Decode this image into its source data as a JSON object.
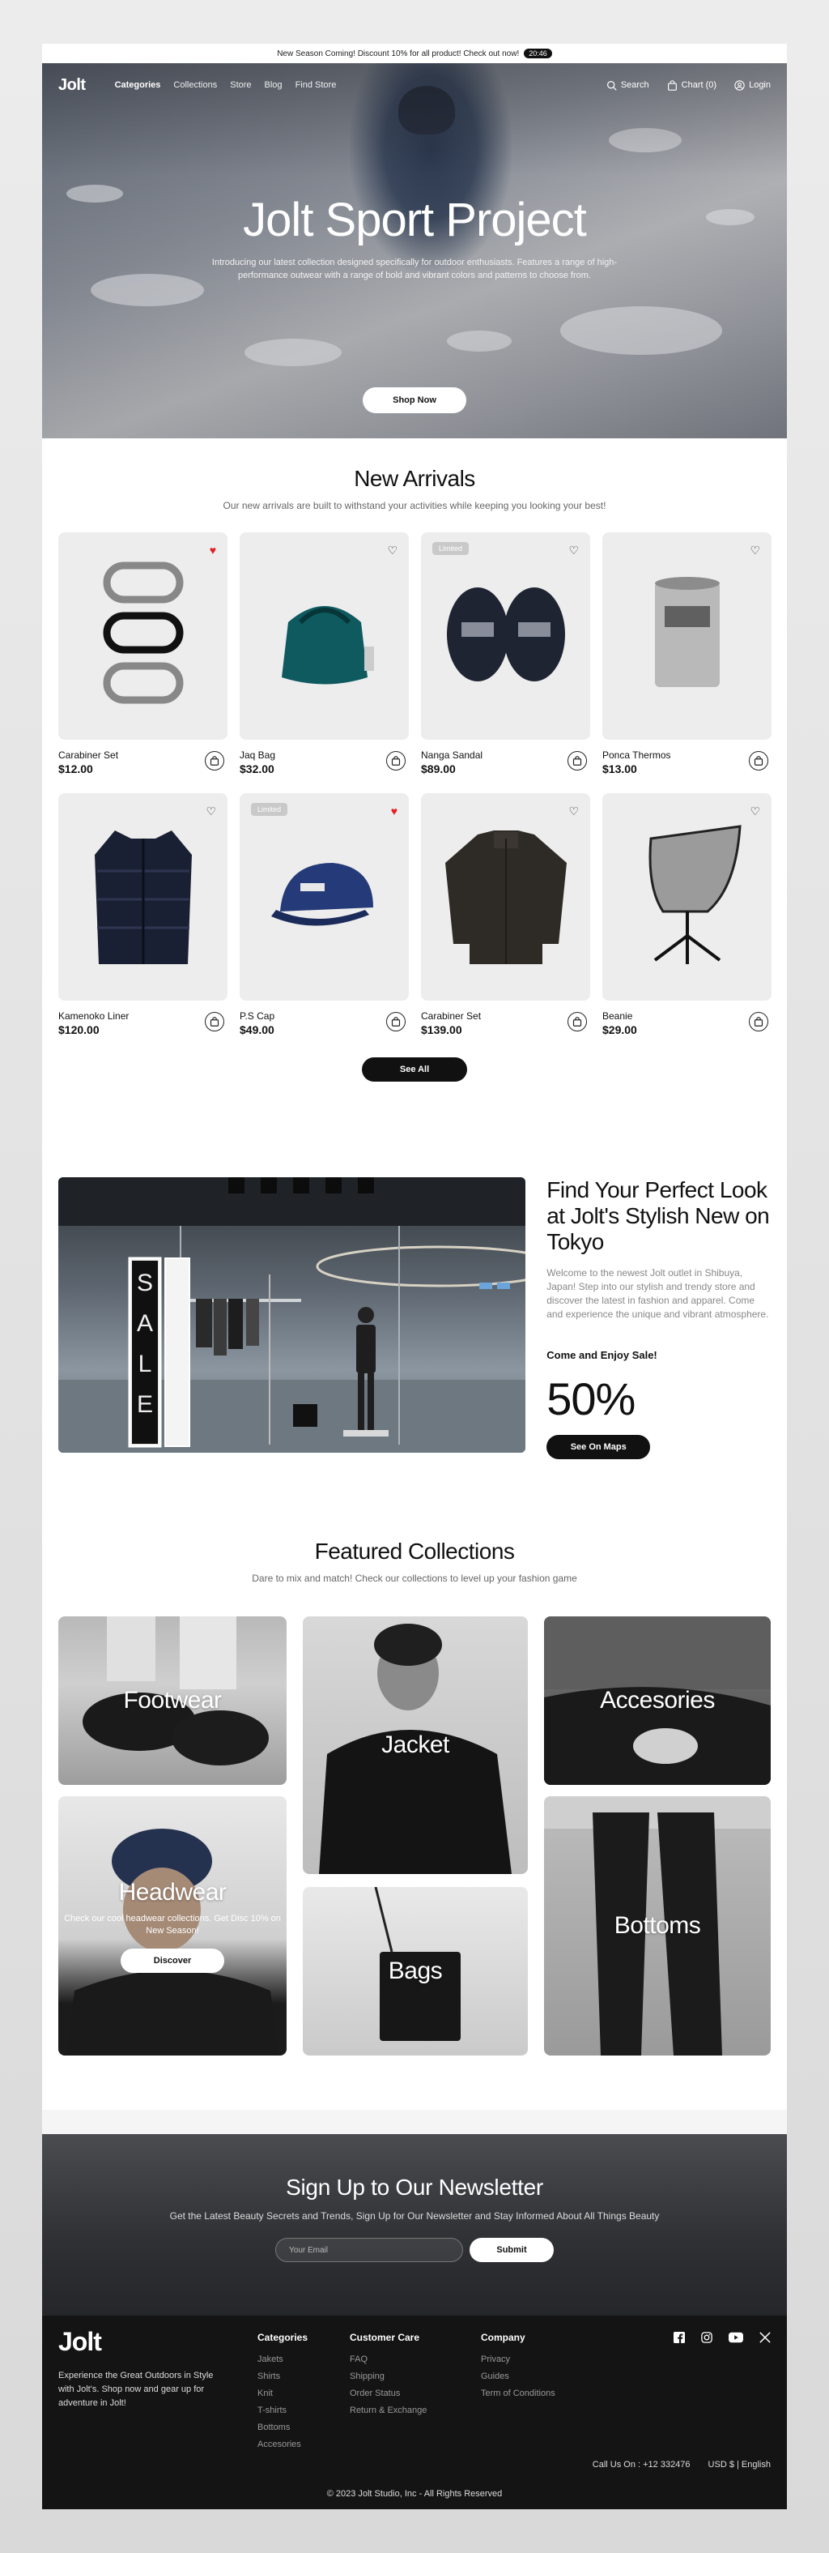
{
  "announcement": {
    "text": "New Season Coming! Discount 10% for all product! Check out now!",
    "timer": "20:46"
  },
  "nav": {
    "logo": "Jolt",
    "links": [
      "Categories",
      "Collections",
      "Store",
      "Blog",
      "Find Store"
    ],
    "search": "Search",
    "chart": "Chart (0)",
    "login": "Login"
  },
  "hero": {
    "title": "Jolt Sport Project",
    "subtitle": "Introducing our latest collection designed specifically for outdoor enthusiasts. Features a range of high-performance outwear with a range of bold and vibrant colors and patterns to choose from.",
    "cta": "Shop Now"
  },
  "arrivals": {
    "title": "New Arrivals",
    "subtitle": "Our new arrivals are built to withstand your activities while keeping you looking your best!",
    "see_all": "See All",
    "items": [
      {
        "name": "Carabiner Set",
        "price": "$12.00",
        "badge": "",
        "fav": true,
        "icon": "carabiner-icon"
      },
      {
        "name": "Jaq Bag",
        "price": "$32.00",
        "badge": "",
        "fav": false,
        "icon": "bag-icon"
      },
      {
        "name": "Nanga Sandal",
        "price": "$89.00",
        "badge": "Limited",
        "fav": false,
        "icon": "sandal-icon"
      },
      {
        "name": "Ponca Thermos",
        "price": "$13.00",
        "badge": "",
        "fav": false,
        "icon": "thermos-icon"
      },
      {
        "name": "Kamenoko Liner",
        "price": "$120.00",
        "badge": "",
        "fav": false,
        "icon": "vest-icon"
      },
      {
        "name": "P.S Cap",
        "price": "$49.00",
        "badge": "Limited",
        "fav": true,
        "icon": "cap-icon"
      },
      {
        "name": "Carabiner Set",
        "price": "$139.00",
        "badge": "",
        "fav": false,
        "icon": "fleece-icon"
      },
      {
        "name": "Beanie",
        "price": "$29.00",
        "badge": "",
        "fav": false,
        "icon": "chair-icon"
      }
    ]
  },
  "store": {
    "title": "Find Your Perfect Look at Jolt's Stylish New on Tokyo",
    "description": "Welcome to the newest Jolt outlet in Shibuya, Japan! Step into our stylish and trendy store and discover the latest in fashion and apparel. Come and experience the unique and vibrant atmosphere.",
    "sale_label": "Come and Enjoy Sale!",
    "discount": "50%",
    "cta": "See On Maps",
    "sign_text": "SALE"
  },
  "featured": {
    "title": "Featured Collections",
    "subtitle": "Dare to mix and match! Check our collections to level up your fashion game",
    "tiles": {
      "footwear": "Footwear",
      "jacket": "Jacket",
      "accesories": "Accesories",
      "headwear": "Headwear",
      "headwear_sub": "Check our cool headwear collections. Get Disc 10% on New Season!",
      "discover": "Discover",
      "bags": "Bags",
      "bottoms": "Bottoms"
    }
  },
  "newsletter": {
    "title": "Sign Up  to Our Newsletter",
    "subtitle": "Get the Latest Beauty Secrets and Trends, Sign Up for Our Newsletter and Stay Informed About All Things Beauty",
    "placeholder": "Your Email",
    "submit": "Submit"
  },
  "footer": {
    "logo": "Jolt",
    "tagline": "Experience the Great Outdoors in Style with Jolt's. Shop now and gear up for adventure in Jolt!",
    "categories_title": "Categories",
    "categories": [
      "Jakets",
      "Shirts",
      "Knit",
      "T-shirts",
      "Bottoms",
      "Accesories"
    ],
    "care_title": "Customer Care",
    "care": [
      "FAQ",
      "Shipping",
      "Order Status",
      "Return & Exchange"
    ],
    "company_title": "Company",
    "company": [
      "Privacy",
      "Guides",
      "Term of Conditions"
    ],
    "social": [
      "facebook-icon",
      "instagram-icon",
      "youtube-icon",
      "x-icon"
    ],
    "phone": "Call Us On : +12 332476",
    "locale": "USD $ | English",
    "copyright": "© 2023 Jolt Studio, Inc - All Rights Reserved"
  },
  "colors": {
    "accent": "#111111",
    "favorite": "#e31e24",
    "card_bg": "#ededed",
    "footer_bg": "#141414"
  }
}
